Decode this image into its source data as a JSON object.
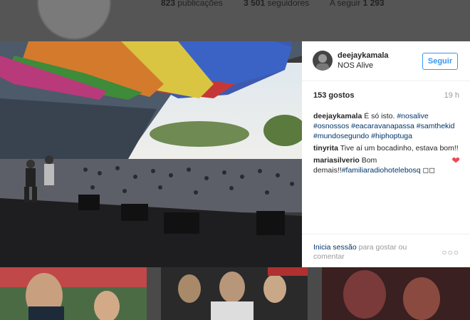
{
  "profile": {
    "posts": "823",
    "posts_label": "publicações",
    "followers": "3 501",
    "followers_label": "seguidores",
    "following_label": "A seguir",
    "following": "1 293"
  },
  "post": {
    "username": "deejaykamala",
    "location": "NOS Alive",
    "follow_label": "Seguir",
    "likes": "153 gostos",
    "time": "19 h",
    "caption_user": "deejaykamala",
    "caption_text": "É só isto.",
    "caption_tags": [
      "#nosalive",
      "#osnossos",
      "#eacaravanapassa",
      "#samthekid",
      "#mundosegundo",
      "#hiphoptuga"
    ],
    "comments": [
      {
        "user": "tinyrita",
        "text": "Tive aí um bocadinho, estava bom!!"
      },
      {
        "user": "mariasilverio",
        "text": "Bom demais!!",
        "tag": "#familiaradiohotelebosq",
        "suffix": "◻◻"
      }
    ],
    "login_link": "Inicia sessão",
    "login_text": "para gostar ou comentar",
    "more_label": "○○○"
  },
  "colors": {
    "accent": "#3897f0",
    "tag": "#003569",
    "heart": "#ed4956"
  }
}
